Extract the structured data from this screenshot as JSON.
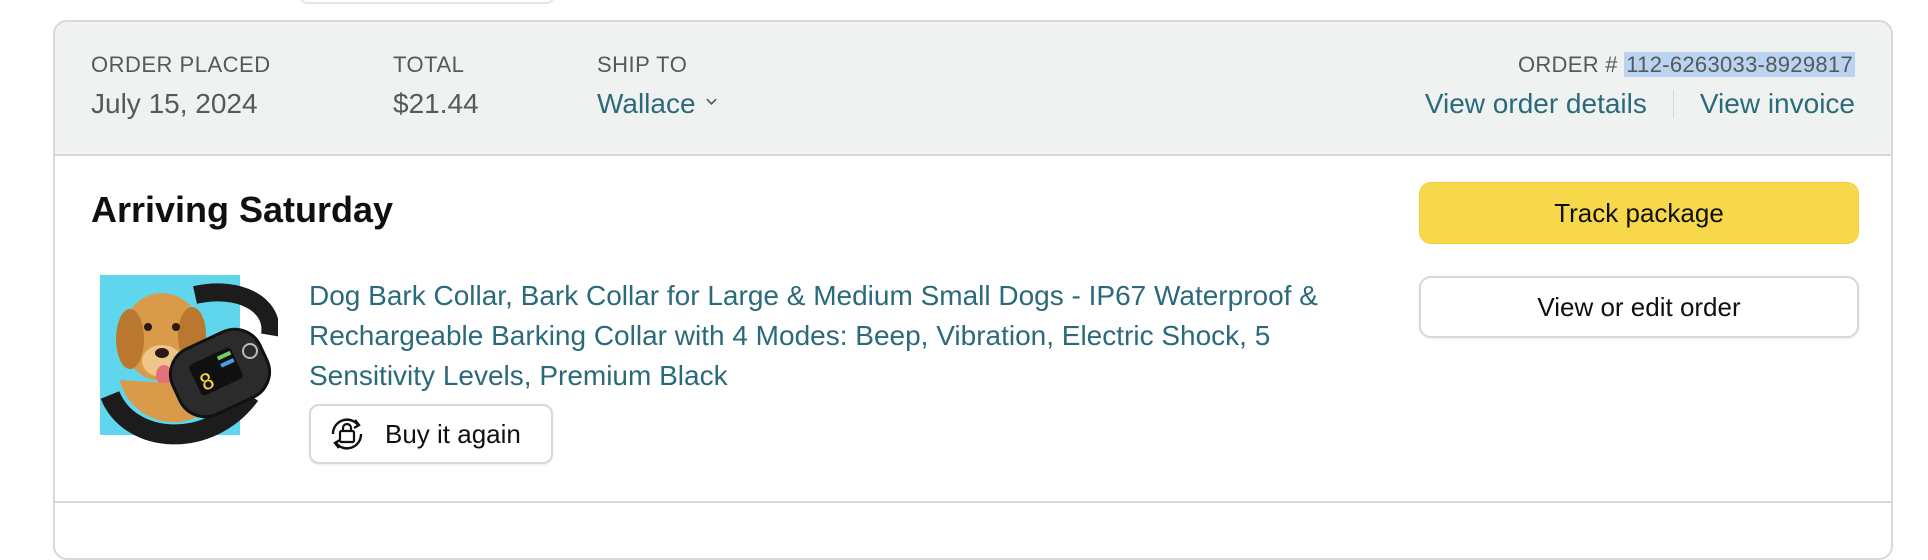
{
  "header": {
    "order_placed_label": "ORDER PLACED",
    "order_placed_value": "July 15, 2024",
    "total_label": "TOTAL",
    "total_value": "$21.44",
    "ship_to_label": "SHIP TO",
    "ship_to_value": "Wallace",
    "order_number_label": "ORDER #",
    "order_number_value": "112-6263033-8929817",
    "view_order_details": "View order details",
    "view_invoice": "View invoice"
  },
  "shipment": {
    "status": "Arriving Saturday",
    "product": {
      "title": "Dog Bark Collar, Bark Collar for Large & Medium Small Dogs - IP67 Waterproof & Rechargeable Barking Collar with 4 Modes: Beep, Vibration, Electric Shock, 5 Sensitivity Levels, Premium Black",
      "image_icon": "dog-bark-collar-product-image"
    },
    "buy_again_label": "Buy it again",
    "buy_again_icon": "buy-again-icon"
  },
  "actions": {
    "track_package": "Track package",
    "view_or_edit_order": "View or edit order"
  },
  "colors": {
    "header_bg": "#f0f2f2",
    "link": "#2a6a7a",
    "track_button": "#f7d84b",
    "border": "#d5d9d9",
    "selection_highlight": "#b9d3f0"
  }
}
